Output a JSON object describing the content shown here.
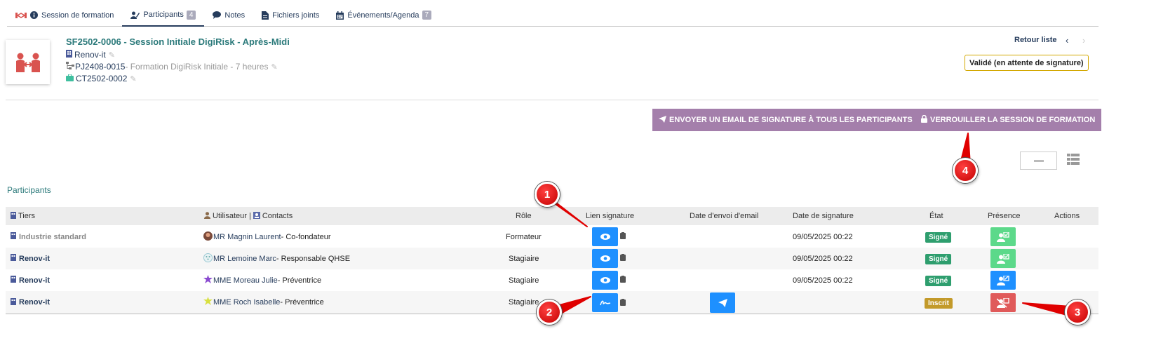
{
  "tabs": [
    {
      "label": "Session de formation",
      "badge": ""
    },
    {
      "label": "Participants",
      "badge": "4"
    },
    {
      "label": "Notes",
      "badge": ""
    },
    {
      "label": "Fichiers joints",
      "badge": ""
    },
    {
      "label": "Événements/Agenda",
      "badge": "7"
    }
  ],
  "header": {
    "title": "SF2502-0006 - Session Initiale DigiRisk - Après-Midi",
    "company": "Renov-it",
    "project_ref": "PJ2408-0015",
    "project_label": " - Formation DigiRisk Initiale - 7 heures",
    "contract_ref": "CT2502-0002",
    "back_label": "Retour liste",
    "status": "Validé (en attente de signature)"
  },
  "actions": {
    "email_all": "ENVOYER UN EMAIL DE SIGNATURE À TOUS LES PARTICIPANTS",
    "lock": "VERROUILLER LA SESSION DE FORMATION"
  },
  "section_title": "Participants",
  "table": {
    "headers": {
      "tiers": "Tiers",
      "user": "Utilisateur | ",
      "contacts": "Contacts",
      "role": "Rôle",
      "link": "Lien signature",
      "email_date": "Date d'envoi d'email",
      "sign_date": "Date de signature",
      "state": "État",
      "presence": "Présence",
      "actions": "Actions"
    },
    "rows": [
      {
        "tiers": "Industrie standard",
        "civility": "MR",
        "name": "Magnin Laurent",
        "title": " - Co-fondateur",
        "role": "Formateur",
        "sign_date": "09/05/2025 00:22",
        "state": "Signé"
      },
      {
        "tiers": "Renov-it",
        "civility": "MR",
        "name": "Lemoine Marc",
        "title": " - Responsable QHSE",
        "role": "Stagiaire",
        "sign_date": "09/05/2025 00:22",
        "state": "Signé"
      },
      {
        "tiers": "Renov-it",
        "civility": "MME",
        "name": "Moreau Julie",
        "title": " - Préventrice",
        "role": "Stagiaire",
        "sign_date": "09/05/2025 00:22",
        "state": "Signé"
      },
      {
        "tiers": "Renov-it",
        "civility": "MME",
        "name": "Roch Isabelle",
        "title": " - Préventrice",
        "role": "Stagiaire",
        "sign_date": "",
        "state": "Inscrit"
      }
    ]
  },
  "callouts": [
    "1",
    "2",
    "3",
    "4"
  ],
  "colors": {
    "accent_teal": "#2c7a7b",
    "navy": "#263c5c",
    "action_purple": "#a47fab",
    "primary_blue": "#1e90ff",
    "signed_green": "#2e9e6e",
    "registered_gold": "#c39a2a",
    "presence_green": "#5cd98a",
    "presence_red": "#e05a5a",
    "callout_red": "#e00000"
  },
  "icons": {
    "session": "handshake-icon",
    "eye": "eye-icon",
    "clipboard": "clipboard-icon",
    "signature": "signature-icon",
    "send": "paper-plane-icon",
    "lock": "lock-icon"
  }
}
